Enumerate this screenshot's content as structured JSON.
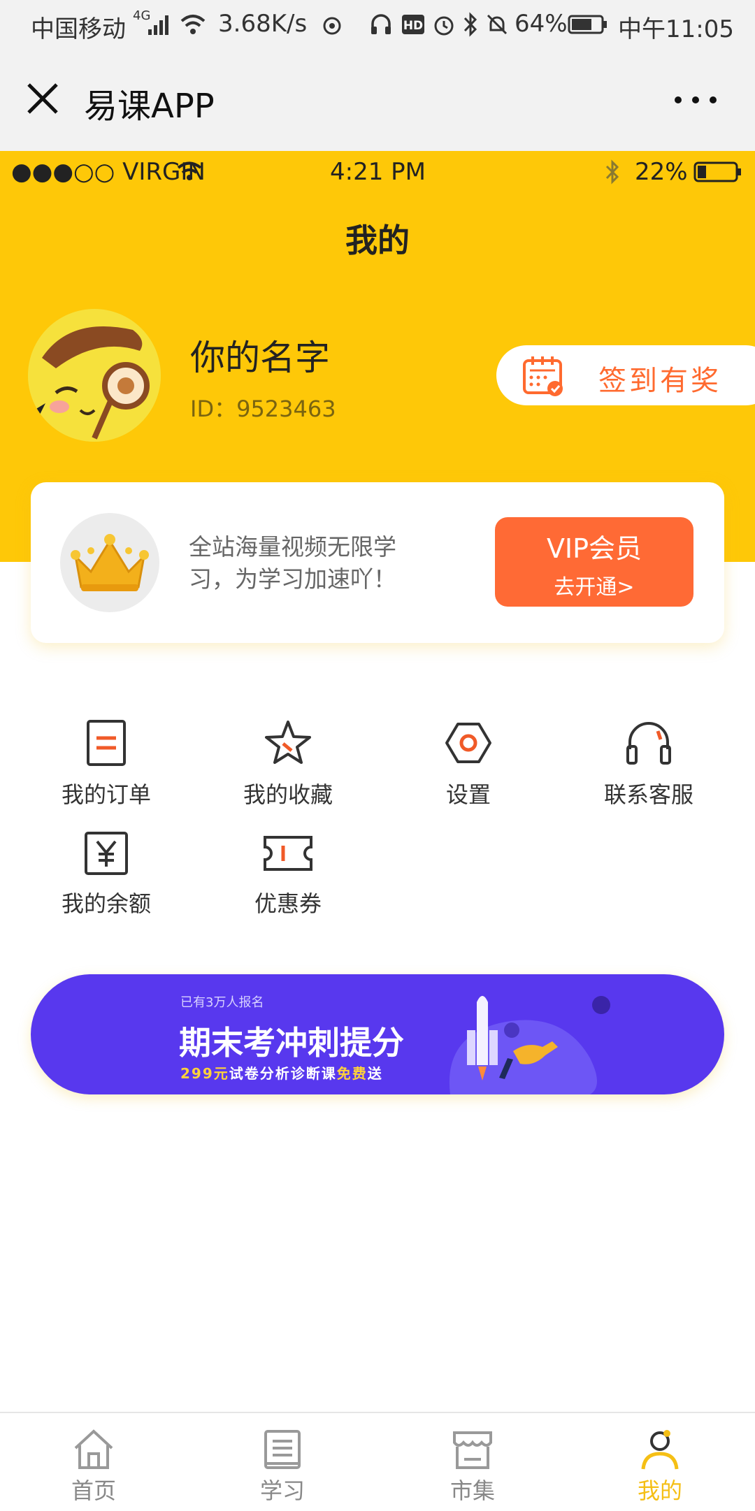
{
  "android_status": {
    "carrier": "中国移动",
    "network": "4G",
    "speed": "3.68K/s",
    "battery": "64%",
    "time": "中午11:05"
  },
  "wechat_header": {
    "title": "易课APP"
  },
  "ios_status": {
    "carrier": "●●●○○ VIRGIN",
    "time": "4:21 PM",
    "battery": "22%"
  },
  "page": {
    "title": "我的"
  },
  "profile": {
    "name": "你的名字",
    "id": "ID：9523463",
    "checkin_label": "签到有奖"
  },
  "vip": {
    "description": "全站海量视频无限学习，为学习加速吖！",
    "button_line1": "VIP会员",
    "button_line2": "去开通>"
  },
  "menu": {
    "items": [
      {
        "label": "我的订单",
        "icon": "order-icon"
      },
      {
        "label": "我的收藏",
        "icon": "star-icon"
      },
      {
        "label": "设置",
        "icon": "settings-icon"
      },
      {
        "label": "联系客服",
        "icon": "headset-icon"
      },
      {
        "label": "我的余额",
        "icon": "yen-icon"
      },
      {
        "label": "优惠券",
        "icon": "coupon-icon"
      }
    ]
  },
  "banner": {
    "subtitle": "已有3万人报名",
    "title": "期末考冲刺提分",
    "promo_price": "299元",
    "promo_text1": "试卷分析诊断课",
    "promo_free": "免费",
    "promo_text2": "送"
  },
  "tabs": [
    {
      "label": "首页",
      "icon": "home-icon",
      "active": false
    },
    {
      "label": "学习",
      "icon": "book-icon",
      "active": false
    },
    {
      "label": "市集",
      "icon": "market-icon",
      "active": false
    },
    {
      "label": "我的",
      "icon": "profile-icon",
      "active": true
    }
  ],
  "colors": {
    "brand_yellow": "#fec808",
    "accent_orange": "#ff6a35",
    "banner_purple": "#5838ee",
    "tab_active": "#f5bf15"
  }
}
